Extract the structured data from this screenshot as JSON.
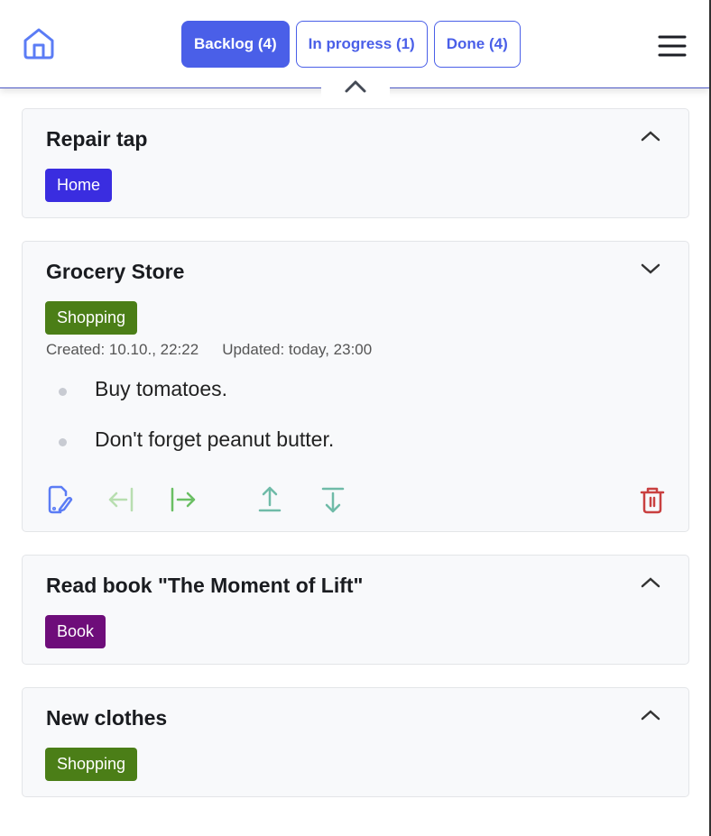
{
  "header": {
    "tabs": [
      {
        "label": "Backlog (4)",
        "active": true
      },
      {
        "label": "In progress (1)",
        "active": false
      },
      {
        "label": "Done (4)",
        "active": false
      }
    ]
  },
  "colors": {
    "accent": "#4a5fe8",
    "home": "#3a3ad8",
    "shopping": "#4b7e17",
    "book": "#6e0d7a",
    "delete": "#c94040"
  },
  "cards": [
    {
      "title": "Repair tap",
      "tag": "Home",
      "expanded": false
    },
    {
      "title": "Grocery Store",
      "tag": "Shopping",
      "expanded": true,
      "created": "Created: 10.10., 22:22",
      "updated": "Updated: today, 23:00",
      "notes": [
        "Buy tomatoes.",
        "Don't forget peanut butter."
      ]
    },
    {
      "title": "Read book \"The Moment of Lift\"",
      "tag": "Book",
      "expanded": false
    },
    {
      "title": "New clothes",
      "tag": "Shopping",
      "expanded": false
    }
  ]
}
